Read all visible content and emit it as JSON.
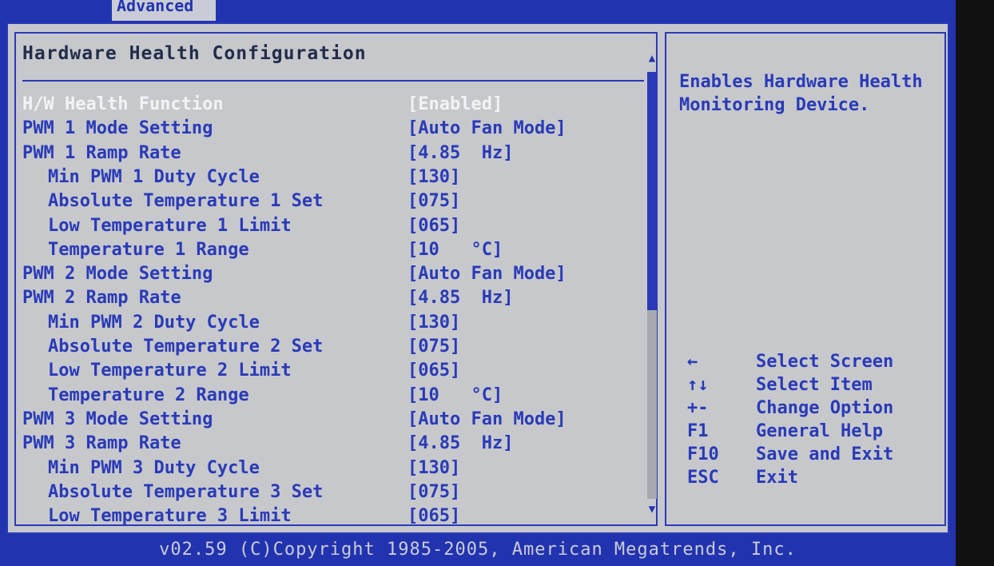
{
  "header": {
    "tab_label": "Advanced"
  },
  "left_panel": {
    "title": "Hardware Health Configuration",
    "scroll_up_icon": "▲",
    "scroll_down_icon": "▼",
    "rows": [
      {
        "label": "H/W Health Function",
        "value": "[Enabled]",
        "indent": false,
        "active": true
      },
      {
        "label": "PWM 1 Mode Setting",
        "value": "[Auto Fan Mode]",
        "indent": false,
        "active": false
      },
      {
        "label": "PWM 1 Ramp Rate",
        "value": "[4.85  Hz]",
        "indent": false,
        "active": false
      },
      {
        "label": "Min PWM 1 Duty Cycle",
        "value": "[130]",
        "indent": true,
        "active": false
      },
      {
        "label": "Absolute Temperature 1 Set",
        "value": "[075]",
        "indent": true,
        "active": false
      },
      {
        "label": "Low Temperature 1 Limit",
        "value": "[065]",
        "indent": true,
        "active": false
      },
      {
        "label": "Temperature 1 Range",
        "value": "[10   °C]",
        "indent": true,
        "active": false
      },
      {
        "label": "PWM 2 Mode Setting",
        "value": "[Auto Fan Mode]",
        "indent": false,
        "active": false
      },
      {
        "label": "PWM 2 Ramp Rate",
        "value": "[4.85  Hz]",
        "indent": false,
        "active": false
      },
      {
        "label": "Min PWM 2 Duty Cycle",
        "value": "[130]",
        "indent": true,
        "active": false
      },
      {
        "label": "Absolute Temperature 2 Set",
        "value": "[075]",
        "indent": true,
        "active": false
      },
      {
        "label": "Low Temperature 2 Limit",
        "value": "[065]",
        "indent": true,
        "active": false
      },
      {
        "label": "Temperature 2 Range",
        "value": "[10   °C]",
        "indent": true,
        "active": false
      },
      {
        "label": "PWM 3 Mode Setting",
        "value": "[Auto Fan Mode]",
        "indent": false,
        "active": false
      },
      {
        "label": "PWM 3 Ramp Rate",
        "value": "[4.85  Hz]",
        "indent": false,
        "active": false
      },
      {
        "label": "Min PWM 3 Duty Cycle",
        "value": "[130]",
        "indent": true,
        "active": false
      },
      {
        "label": "Absolute Temperature 3 Set",
        "value": "[075]",
        "indent": true,
        "active": false
      },
      {
        "label": "Low Temperature 3 Limit",
        "value": "[065]",
        "indent": true,
        "active": false
      }
    ]
  },
  "right_panel": {
    "help_text": "Enables Hardware Health Monitoring Device.",
    "keys": [
      {
        "key": "←",
        "desc": "Select Screen"
      },
      {
        "key": "↑↓",
        "desc": "Select Item"
      },
      {
        "key": "+-",
        "desc": "Change Option"
      },
      {
        "key": "F1",
        "desc": "General Help"
      },
      {
        "key": "F10",
        "desc": "Save and Exit"
      },
      {
        "key": "ESC",
        "desc": "Exit"
      }
    ]
  },
  "footer": {
    "text": "v02.59 (C)Copyright 1985-2005, American Megatrends, Inc."
  },
  "colors": {
    "screen_bg": "#2233b0",
    "panel_bg": "#c6c8cc",
    "text_blue": "#2a3ab8",
    "highlight_white": "#f2f3f7"
  }
}
